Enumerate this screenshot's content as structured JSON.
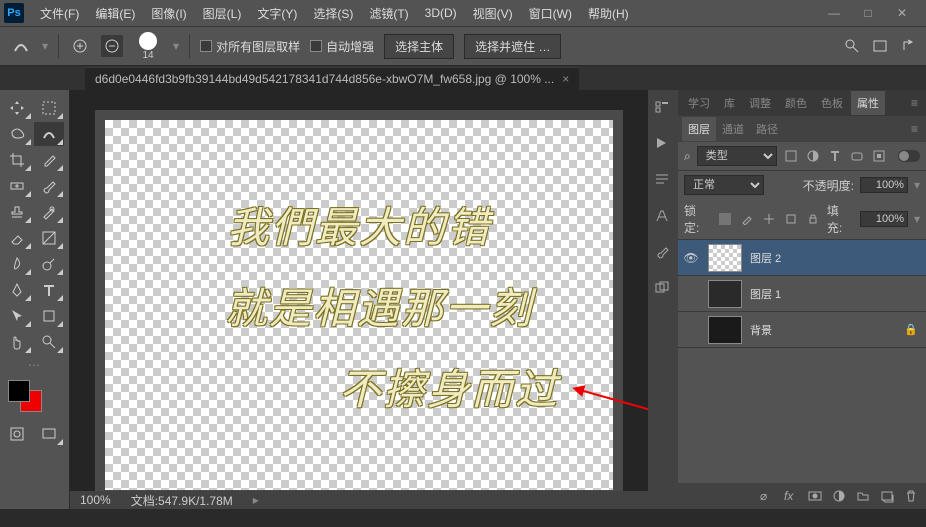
{
  "menubar": [
    "文件(F)",
    "编辑(E)",
    "图像(I)",
    "图层(L)",
    "文字(Y)",
    "选择(S)",
    "滤镜(T)",
    "3D(D)",
    "视图(V)",
    "窗口(W)",
    "帮助(H)"
  ],
  "options": {
    "brush_size": "14",
    "sample_all": "对所有图层取样",
    "auto_enhance": "自动增强",
    "select_subject": "选择主体",
    "select_and_mask": "选择并遮住 …"
  },
  "document": {
    "tab_title": "d6d0e0446fd3b9fb39144bd49d542178341d744d856e-xbwO7M_fw658.jpg @ 100% ...",
    "zoom": "100%",
    "doc_info": "文档:547.9K/1.78M"
  },
  "canvas_text": {
    "line1": "我們最大的错",
    "line2": "就是相遇那一刻",
    "line3": "不擦身而过"
  },
  "panel_tabs_top": [
    "学习",
    "库",
    "调整",
    "颜色",
    "色板",
    "属性"
  ],
  "layers_panel": {
    "tabs": [
      "图层",
      "通道",
      "路径"
    ],
    "kind_label": "类型",
    "blend_mode": "正常",
    "opacity_label": "不透明度:",
    "opacity_value": "100%",
    "lock_label": "锁定:",
    "fill_label": "填充:",
    "fill_value": "100%",
    "layers": [
      {
        "name": "图层 2",
        "visible": true,
        "selected": true,
        "thumb": "checker"
      },
      {
        "name": "图层 1",
        "visible": false,
        "selected": false,
        "thumb": "dark"
      },
      {
        "name": "背景",
        "visible": false,
        "selected": false,
        "thumb": "dark2",
        "locked": true
      }
    ]
  },
  "filter_icons": [
    "image-icon",
    "adjust-icon",
    "text-icon",
    "shape-icon",
    "smart-icon"
  ],
  "lock_icons": [
    "transparency-icon",
    "brush-icon",
    "move-icon",
    "artboard-icon",
    "lock-icon"
  ]
}
